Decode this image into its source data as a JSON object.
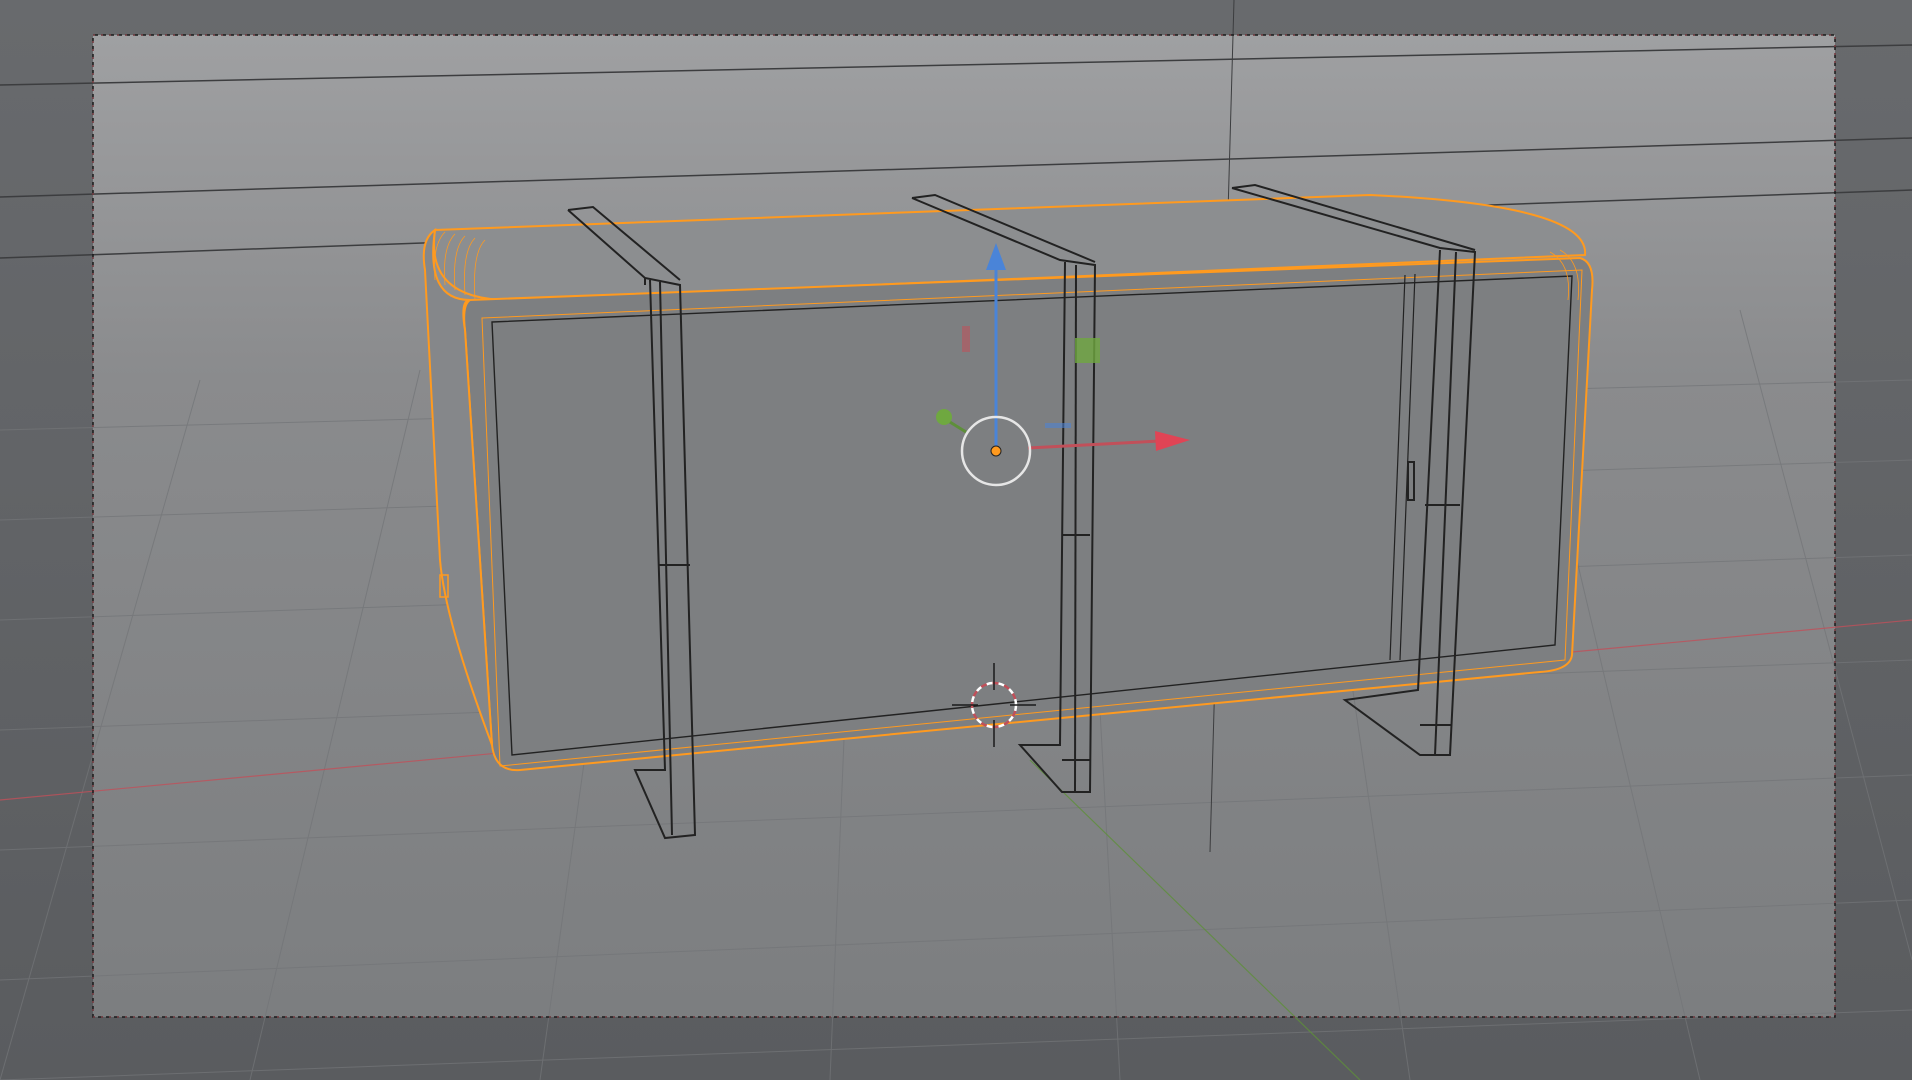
{
  "viewport": {
    "view_mode": "camera-perspective",
    "shading": "wireframe",
    "selected_object": "cabinet",
    "gizmo": "transform-translate",
    "show_grid": true,
    "show_3d_cursor": true
  },
  "colors": {
    "background": "#5c5e61",
    "camera_frame_fill": "#838587",
    "grid_line": "#6f7174",
    "x_axis": "#c1505a",
    "y_axis": "#5e8f3a",
    "z_axis": "#4a84d8",
    "selection_outline": "#ff9a1f",
    "wire": "#222222"
  }
}
